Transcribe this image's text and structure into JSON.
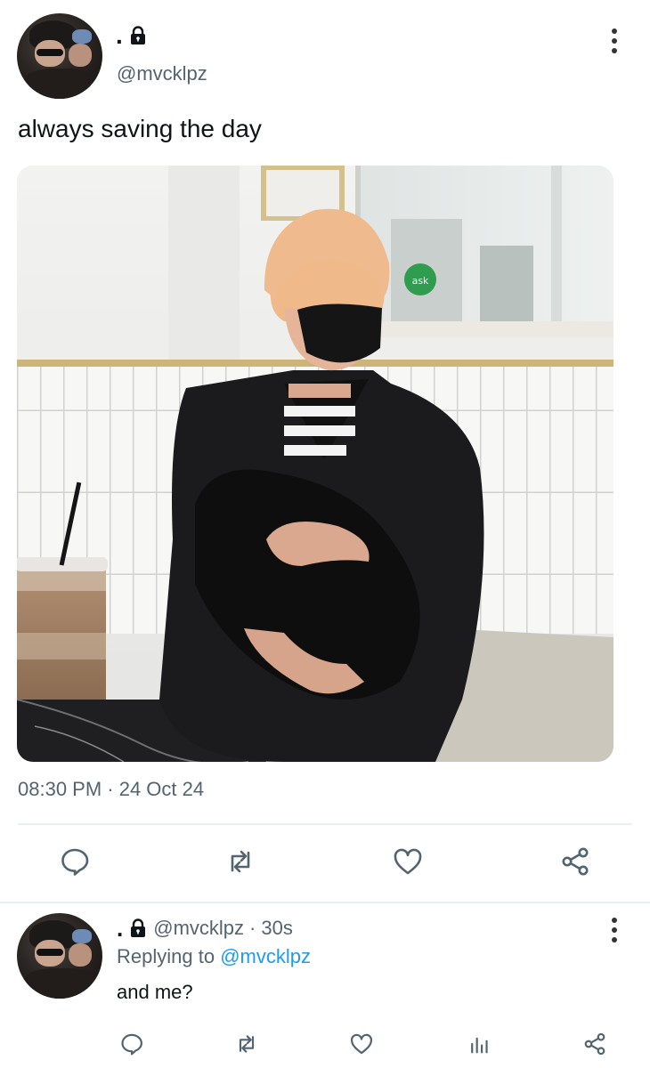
{
  "tweet": {
    "display_name": ".",
    "handle": "@mvcklpz",
    "text": "always saving the day",
    "timestamp": "08:30 PM · 24 Oct 24",
    "avatar_icon": "profile-photo",
    "locked_icon": "lock-icon",
    "photo_sign": "ask"
  },
  "actions": {
    "reply_icon": "reply-icon",
    "retweet_icon": "retweet-icon",
    "like_icon": "heart-icon",
    "share_icon": "share-icon"
  },
  "reply": {
    "display_name": ".",
    "handle": "@mvcklpz",
    "age": "30s",
    "separator": "·",
    "replying_prefix": "Replying to",
    "replying_to": "@mvcklpz",
    "text": "and me?",
    "views_icon": "views-icon"
  },
  "colors": {
    "text": "#0f1419",
    "secondary": "#536471",
    "link": "#1d9bf0",
    "divider": "#eceff1"
  }
}
